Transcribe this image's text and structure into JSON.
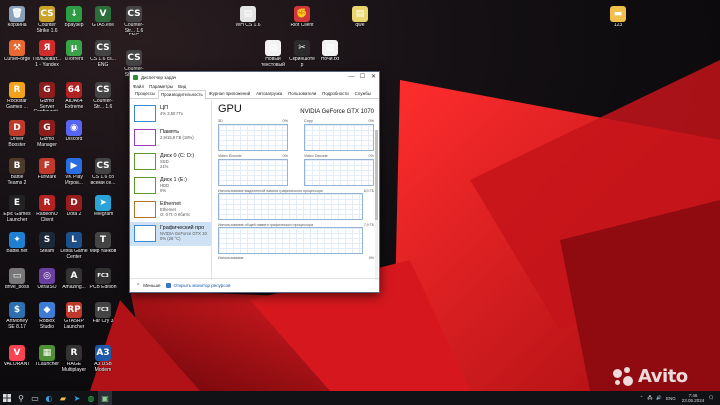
{
  "desktop": {
    "icons": [
      {
        "label": "Корзина",
        "glyph": "🗑",
        "color": "#8aa0b8"
      },
      {
        "label": "Counter Strike 1.6",
        "glyph": "CS",
        "color": "#c9a227"
      },
      {
        "label": "Браузер",
        "glyph": "↓",
        "color": "#2d9c43"
      },
      {
        "label": "GTA5.exe",
        "glyph": "V",
        "color": "#2c6e3a"
      },
      {
        "label": "Counter-Str... 1.6 ENG",
        "glyph": "CS",
        "color": "#444"
      },
      {
        "label": "CurseForge",
        "glyph": "⚒",
        "color": "#e8692f"
      },
      {
        "label": "Пользоват... 1 - Yandex",
        "glyph": "Я",
        "color": "#d12b2b"
      },
      {
        "label": "uTorrent",
        "glyph": "µ",
        "color": "#3aa34a"
      },
      {
        "label": "CS 1.6 cs... ENG",
        "glyph": "CS",
        "color": "#444"
      },
      {
        "label": "Counter-Str... 1.6 RUS",
        "glyph": "CS",
        "color": "#444"
      },
      {
        "label": "Rockstar Games ...",
        "glyph": "R",
        "color": "#f2a31b"
      },
      {
        "label": "Gizmo Server Configurati...",
        "glyph": "G",
        "color": "#8b1d1d"
      },
      {
        "label": "AIDA64 Extreme",
        "glyph": "64",
        "color": "#b22222"
      },
      {
        "label": "Counter-Str... 1.6",
        "glyph": "CS",
        "color": "#444"
      },
      {
        "label": "Driver Booster",
        "glyph": "D",
        "color": "#c0392b"
      },
      {
        "label": "Gizmo Manager",
        "glyph": "G",
        "color": "#8b1d1d"
      },
      {
        "label": "Discord",
        "glyph": "◉",
        "color": "#5865f2"
      },
      {
        "label": "Battle Teams 2",
        "glyph": "B",
        "color": "#4d3a2a"
      },
      {
        "label": "FurMark",
        "glyph": "F",
        "color": "#c0392b"
      },
      {
        "label": "VK Play Игров...",
        "glyph": "▶",
        "color": "#2a6de0"
      },
      {
        "label": "CS 1.6 со всеми се...",
        "glyph": "CS",
        "color": "#444"
      },
      {
        "label": "Epic Games Launcher",
        "glyph": "E",
        "color": "#222"
      },
      {
        "label": "RadeonO Client",
        "glyph": "R",
        "color": "#b72121"
      },
      {
        "label": "Dota 2",
        "glyph": "D",
        "color": "#9a1d1d"
      },
      {
        "label": "Telegram",
        "glyph": "➤",
        "color": "#2aa3d8"
      },
      {
        "label": "Battle.net",
        "glyph": "✦",
        "color": "#1f7fd1"
      },
      {
        "label": "Steam",
        "glyph": "S",
        "color": "#1b2838"
      },
      {
        "label": "Lesta Game Center",
        "glyph": "L",
        "color": "#1d4f8a"
      },
      {
        "label": "Мир танков",
        "glyph": "Т",
        "color": "#444"
      },
      {
        "label": "drive_boss",
        "glyph": "▭",
        "color": "#777"
      },
      {
        "label": "UltraISO",
        "glyph": "◎",
        "color": "#6b3fa0"
      },
      {
        "label": "Amazing...",
        "glyph": "A",
        "color": "#333"
      },
      {
        "label": "PCB Edition",
        "glyph": "FC3",
        "color": "#333"
      },
      {
        "label": "ArtMoney SE 8.17",
        "glyph": "$",
        "color": "#2d6fb0"
      },
      {
        "label": "Roblox Studio",
        "glyph": "◆",
        "color": "#3c7cd6"
      },
      {
        "label": "GTA5RP Launcher",
        "glyph": "RP",
        "color": "#c0392b"
      },
      {
        "label": "Far Cry 3",
        "glyph": "FC3",
        "color": "#444"
      },
      {
        "label": "VALORANT",
        "glyph": "V",
        "color": "#fa4454"
      },
      {
        "label": "TLauncher",
        "glyph": "▦",
        "color": "#4f8f35"
      },
      {
        "label": "RAGE Multiplayer",
        "glyph": "R",
        "color": "#333"
      },
      {
        "label": "A3 USB Modem",
        "glyph": "A3",
        "color": "#1e58a8"
      },
      {
        "label": "WH CS 1.6",
        "glyph": "▤",
        "color": "#e4e4e4"
      },
      {
        "label": "Riot Client",
        "glyph": "✊",
        "color": "#d13639"
      },
      {
        "label": "qwe",
        "glyph": "▤",
        "color": "#e9d56c"
      },
      {
        "label": "123",
        "glyph": "▬",
        "color": "#f0c04a"
      },
      {
        "label": "Новый текстовый ...",
        "glyph": "▤",
        "color": "#f2f2f2"
      },
      {
        "label": "Скриншотер",
        "glyph": "✂",
        "color": "#2b2b2b"
      },
      {
        "label": "Ночи.txt",
        "glyph": "▤",
        "color": "#f2f2f2"
      }
    ]
  },
  "task_manager": {
    "title": "Диспетчер задач",
    "menu": [
      "Файл",
      "Параметры",
      "Вид"
    ],
    "tabs": [
      "Процессы",
      "Производительность",
      "Журнал приложений",
      "Автозагрузка",
      "Пользователи",
      "Подробности",
      "Службы"
    ],
    "active_tab": "Производительность",
    "resources": [
      {
        "name": "ЦП",
        "sub1": "4% 3,50 ГГц",
        "sub2": "",
        "color": "#3a8ad0"
      },
      {
        "name": "Память",
        "sub1": "2,9/15,9 ГБ (18%)",
        "sub2": "",
        "color": "#9a3fb8"
      },
      {
        "name": "Диск 0 (C: D:)",
        "sub1": "SSD",
        "sub2": "21%",
        "color": "#5d9a2e"
      },
      {
        "name": "Диск 1 (E:)",
        "sub1": "HDD",
        "sub2": "0%",
        "color": "#5d9a2e"
      },
      {
        "name": "Ethernet",
        "sub1": "Ethernet",
        "sub2": "О: 0 П: 0 Кбит/с",
        "color": "#b5722a"
      },
      {
        "name": "Графический про",
        "sub1": "NVIDIA GeForce GTX 10",
        "sub2": "0% (26 °C)",
        "color": "#3a8ad0"
      }
    ],
    "gpu": {
      "title": "GPU",
      "model": "NVIDIA GeForce GTX 1070",
      "engines": [
        {
          "label": "3D",
          "pct": "0%"
        },
        {
          "label": "Copy",
          "pct": "0%"
        },
        {
          "label": "Video Encode",
          "pct": "0%"
        },
        {
          "label": "Video Decode",
          "pct": "0%"
        }
      ],
      "dedicated_label": "Использование выделенной памяти графического процессора",
      "dedicated_value": "8,0 ГБ",
      "shared_label": "Использование общей памяти графического процессора",
      "shared_value": "7,9 ГБ",
      "usage_label": "Использование",
      "usage_pct": "0%"
    },
    "footer": {
      "less": "Меньше",
      "monitor": "Открыть монитор ресурсов"
    }
  },
  "taskbar": {
    "search_icon": "search-icon",
    "lang": "ENG",
    "time": "7:46",
    "date": "23.05.2024"
  },
  "watermark": {
    "text": "Avito"
  }
}
